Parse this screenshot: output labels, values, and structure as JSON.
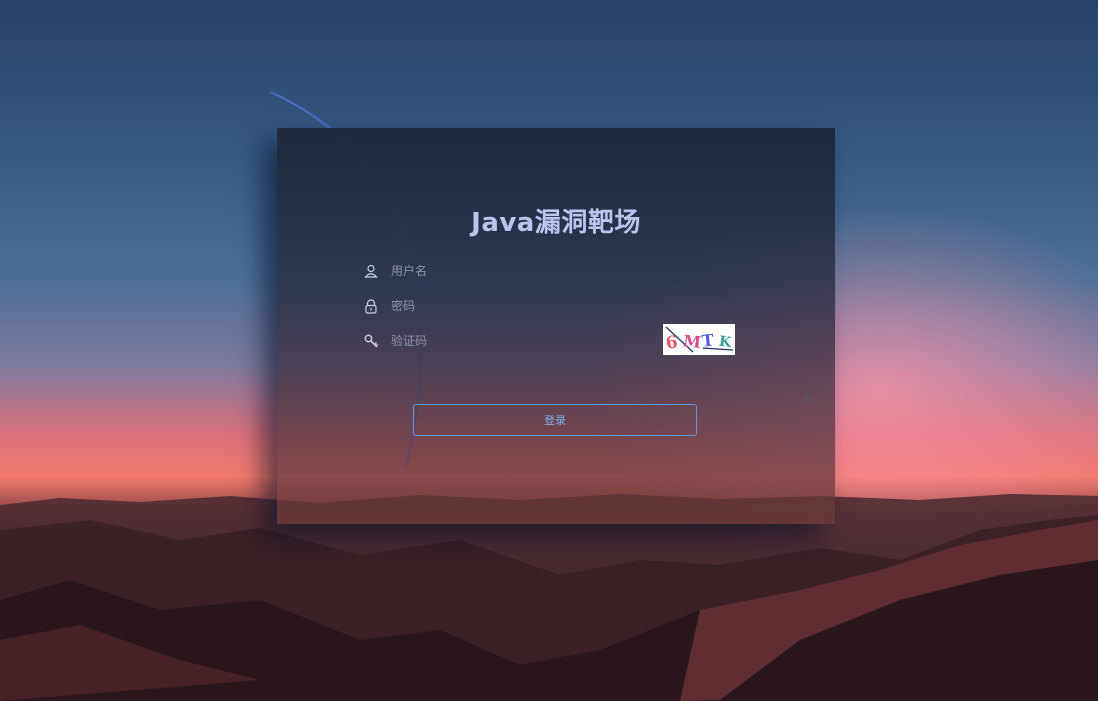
{
  "login": {
    "title": "Java漏洞靶场",
    "username_placeholder": "用户名",
    "password_placeholder": "密码",
    "captcha_placeholder": "验证码",
    "captcha_text": "6MTK",
    "submit_label": "登录"
  },
  "icons": {
    "username": "user-icon",
    "password": "lock-icon",
    "captcha": "key-icon"
  },
  "colors": {
    "title": "#b9c4ef",
    "button_border": "#5a9ae0",
    "button_text": "#7fb4ee"
  }
}
